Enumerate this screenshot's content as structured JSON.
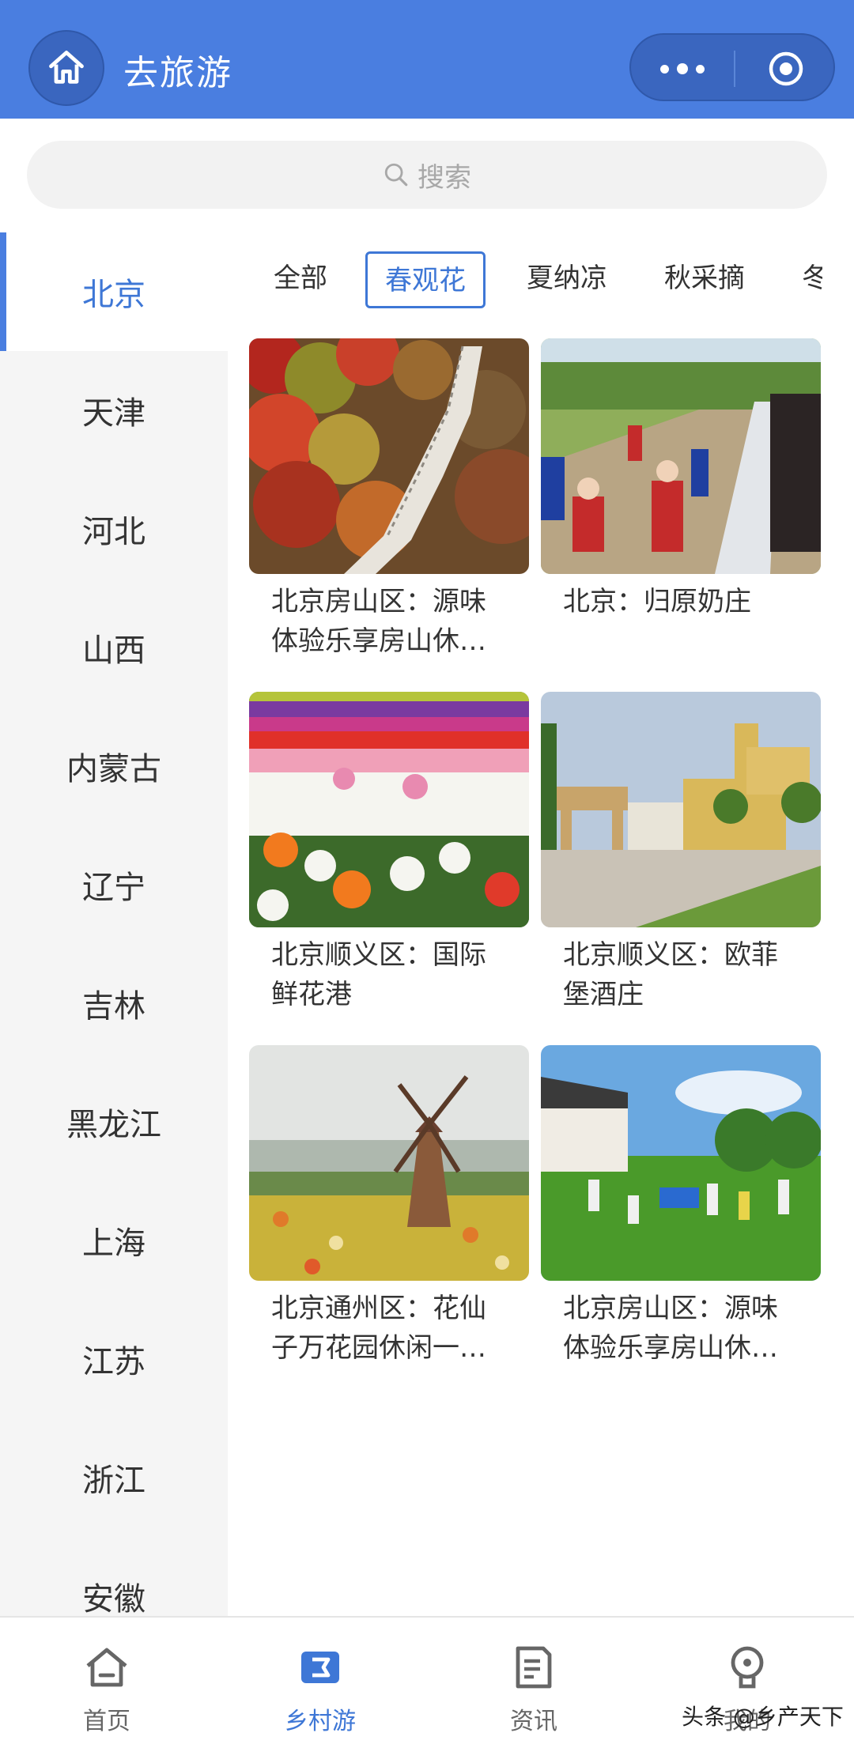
{
  "header": {
    "title": "去旅游",
    "home_icon": "home-icon",
    "more_icon": "more-dots-icon",
    "close_icon": "target-close-icon",
    "color": "#4a7ee0"
  },
  "search": {
    "placeholder": "搜索",
    "icon": "search-icon"
  },
  "sidebar": {
    "items": [
      {
        "label": "北京",
        "active": true
      },
      {
        "label": "天津"
      },
      {
        "label": "河北"
      },
      {
        "label": "山西"
      },
      {
        "label": "内蒙古"
      },
      {
        "label": "辽宁"
      },
      {
        "label": "吉林"
      },
      {
        "label": "黑龙江"
      },
      {
        "label": "上海"
      },
      {
        "label": "江苏"
      },
      {
        "label": "浙江"
      },
      {
        "label": "安徽"
      }
    ]
  },
  "tabs": [
    {
      "label": "全部"
    },
    {
      "label": "春观花",
      "active": true
    },
    {
      "label": "夏纳凉"
    },
    {
      "label": "秋采摘"
    },
    {
      "label": "冬"
    }
  ],
  "cards": [
    {
      "title": "北京房山区：源味体验乐享房山休…"
    },
    {
      "title": "北京：归原奶庄"
    },
    {
      "title": "北京顺义区：国际鲜花港"
    },
    {
      "title": "北京顺义区：欧菲堡酒庄"
    },
    {
      "title": "北京通州区：花仙子万花园休闲一…"
    },
    {
      "title": "北京房山区：源味体验乐享房山休…"
    }
  ],
  "bottom_nav": [
    {
      "label": "首页",
      "icon": "home-outline-icon"
    },
    {
      "label": "乡村游",
      "icon": "rural-tour-icon",
      "active": true
    },
    {
      "label": "资讯",
      "icon": "news-icon"
    },
    {
      "label": "我的",
      "icon": "profile-icon"
    }
  ],
  "watermark": "头条 @乡产天下",
  "colors": {
    "accent": "#3e77d6",
    "sidebar_bg": "#f5f5f5"
  }
}
